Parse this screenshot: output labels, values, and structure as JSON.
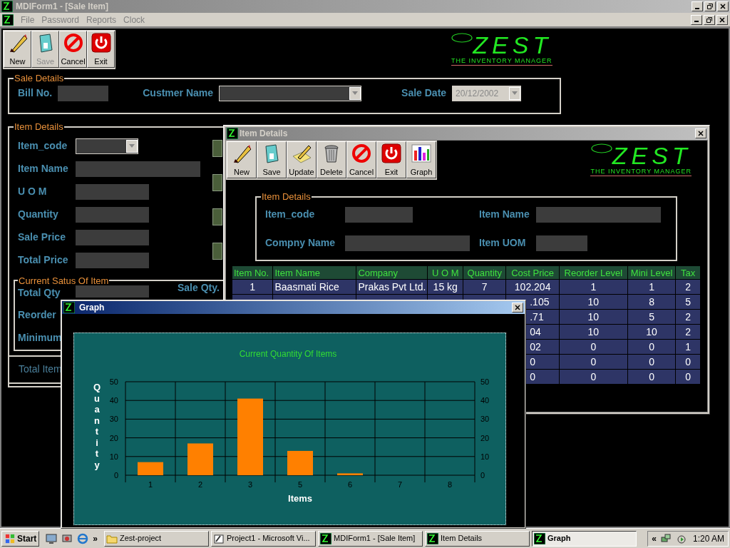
{
  "main_window": {
    "title": "MDIForm1 - [Sale Item]"
  },
  "menu": [
    "File",
    "Password",
    "Reports",
    "Clock"
  ],
  "main_toolbar": [
    {
      "label": "New",
      "kind": "new",
      "disabled": false
    },
    {
      "label": "Save",
      "kind": "save",
      "disabled": true
    },
    {
      "label": "Cancel",
      "kind": "cancel",
      "disabled": false
    },
    {
      "label": "Exit",
      "kind": "exit",
      "disabled": false
    }
  ],
  "logo": {
    "name": "ZEST",
    "tagline": "THE INVENTORY MANAGER"
  },
  "sale_details": {
    "title": "Sale Details",
    "fields": [
      {
        "label": "Bill No.",
        "kind": "text",
        "disabled": false
      },
      {
        "label": "Custmer Name",
        "kind": "combo",
        "disabled": false
      },
      {
        "label": "Sale Date",
        "kind": "combo",
        "value": "20/12/2002",
        "disabled": true
      }
    ]
  },
  "item_details": {
    "title": "Item Details",
    "fields": [
      {
        "label": "Item_code",
        "kind": "combo"
      },
      {
        "label": "Item Name",
        "kind": "text"
      },
      {
        "label": "U O M",
        "kind": "text"
      },
      {
        "label": "Quantity",
        "kind": "text"
      },
      {
        "label": "Sale Price",
        "kind": "text"
      },
      {
        "label": "Total Price",
        "kind": "text"
      }
    ]
  },
  "current_status": {
    "title": "Current Satus Of Item",
    "labels": [
      "Total Qty",
      "Reorder",
      "Minimum"
    ],
    "sale_qty_label": "Sale Qty."
  },
  "total_items_label": "Total Item",
  "item_window": {
    "title": "Item Details",
    "toolbar": [
      {
        "label": "New",
        "kind": "new"
      },
      {
        "label": "Save",
        "kind": "save"
      },
      {
        "label": "Update",
        "kind": "update"
      },
      {
        "label": "Delete",
        "kind": "delete"
      },
      {
        "label": "Cancel",
        "kind": "cancel"
      },
      {
        "label": "Exit",
        "kind": "exit"
      },
      {
        "label": "Graph",
        "kind": "graph"
      }
    ],
    "logo": {
      "name": "ZEST",
      "tagline": "THE INVENTORY MANAGER"
    },
    "group_title": "Item Details",
    "fields": [
      {
        "label": "Item_code"
      },
      {
        "label": "Item Name"
      },
      {
        "label": "Compny Name"
      },
      {
        "label": "Item UOM"
      }
    ],
    "table": {
      "columns": [
        "Item No.",
        "Item Name",
        "Company",
        "U O M",
        "Quantity",
        "Cost Price",
        "Reorder Level",
        "Mini Level",
        "Tax"
      ],
      "rows": [
        [
          "1",
          "Baasmati Rice",
          "Prakas Pvt Ltd.",
          "15 kg",
          "7",
          "102.204",
          "1",
          "1",
          "2"
        ],
        [
          ".105",
          "10",
          "8",
          "5"
        ],
        [
          ".71",
          "10",
          "5",
          "2"
        ],
        [
          "04",
          "10",
          "10",
          "2"
        ],
        [
          "02",
          "0",
          "0",
          "1"
        ],
        [
          "0",
          "0",
          "0",
          "0"
        ],
        [
          "0",
          "0",
          "0",
          "0"
        ]
      ]
    }
  },
  "graph_window": {
    "title": "Graph",
    "chart_data": {
      "type": "bar",
      "title": "Current Quantity Of Items",
      "xlabel": "Items",
      "ylabel": "Quantity",
      "categories": [
        "1",
        "2",
        "3",
        "5",
        "6",
        "7",
        "8"
      ],
      "series": [
        {
          "color": "#ff8000",
          "values": [
            7,
            17,
            41,
            13,
            1,
            0,
            0
          ]
        }
      ],
      "ylim": [
        0,
        50
      ],
      "yticks": [
        0,
        10,
        20,
        30,
        40,
        50
      ],
      "y2ticks": [
        0,
        10,
        20,
        30,
        40,
        50
      ],
      "y2lim": [
        0,
        50
      ],
      "grid": true
    }
  },
  "taskbar": {
    "start": "Start",
    "more": "»",
    "tasks": [
      {
        "label": "Zest-project",
        "kind": "folder",
        "selected": false
      },
      {
        "label": "Project1 - Microsoft Vi...",
        "kind": "vb",
        "selected": false
      },
      {
        "label": "MDIForm1 - [Sale Item]",
        "kind": "zest",
        "selected": false
      },
      {
        "label": "Item Details",
        "kind": "zest",
        "selected": false
      },
      {
        "label": "Graph",
        "kind": "zest",
        "selected": true
      }
    ],
    "tray_expand": "«",
    "clock": "1:20 AM"
  }
}
